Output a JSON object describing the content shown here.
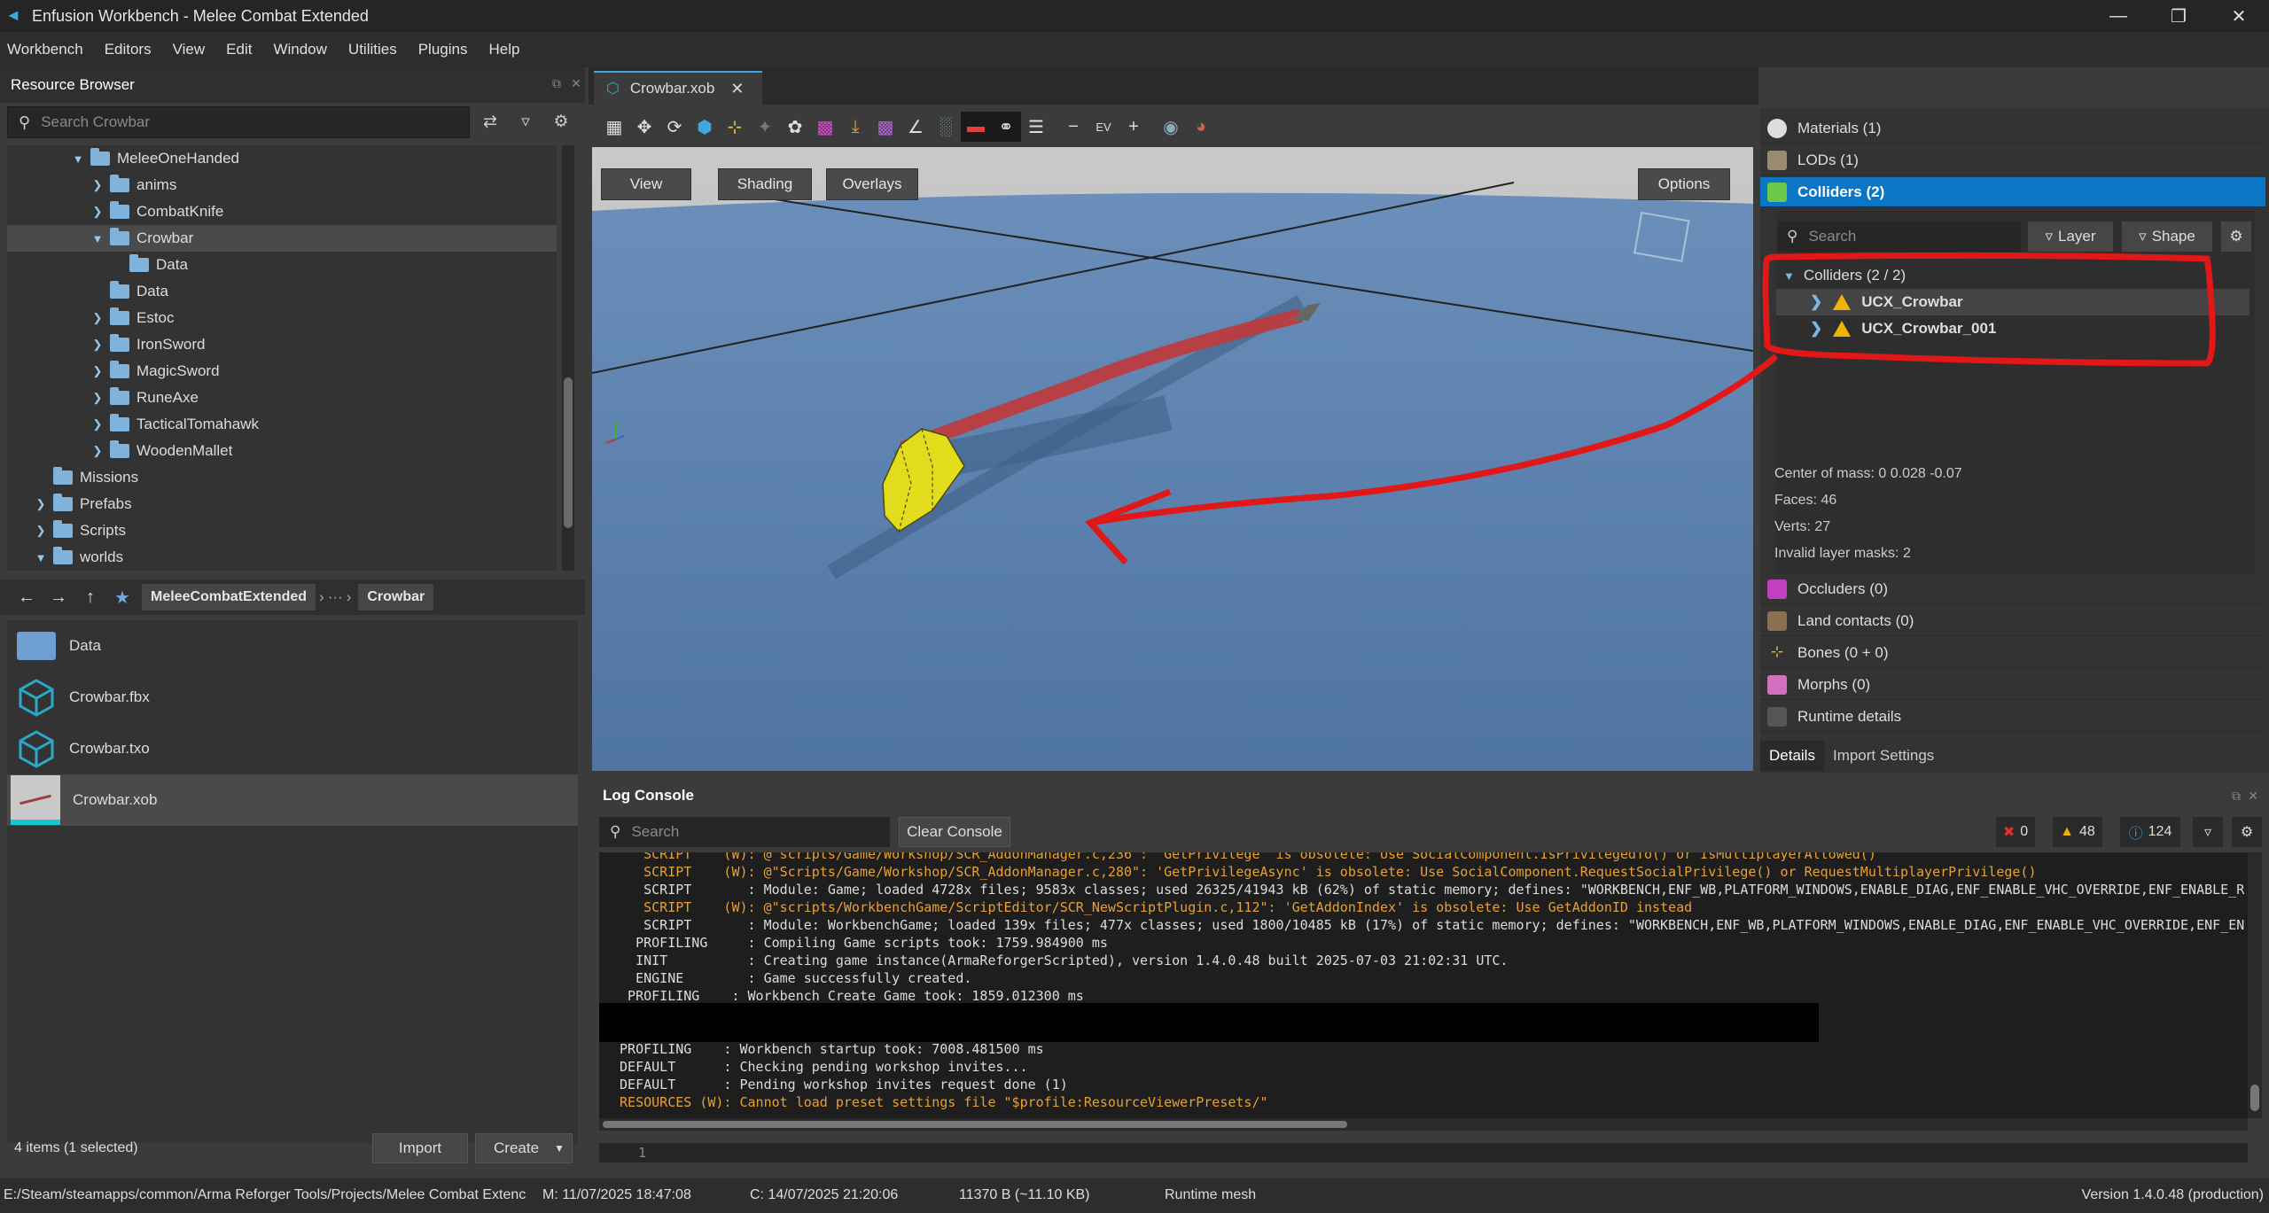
{
  "window": {
    "title": "Enfusion Workbench - Melee Combat Extended",
    "minimize": "—",
    "maximize": "❐",
    "close": "✕"
  },
  "menu": [
    "Workbench",
    "Editors",
    "View",
    "Edit",
    "Window",
    "Utilities",
    "Plugins",
    "Help"
  ],
  "resource_browser": {
    "title": "Resource Browser",
    "search_placeholder": "Search Crowbar",
    "tree": [
      {
        "label": "MeleeOneHanded",
        "expanded": true
      },
      {
        "label": "anims",
        "expanded": false
      },
      {
        "label": "CombatKnife",
        "expanded": false
      },
      {
        "label": "Crowbar",
        "expanded": true,
        "selected": true
      },
      {
        "label": "Data",
        "expanded": null
      },
      {
        "label": "Data",
        "expanded": null
      },
      {
        "label": "Estoc",
        "expanded": false
      },
      {
        "label": "IronSword",
        "expanded": false
      },
      {
        "label": "MagicSword",
        "expanded": false
      },
      {
        "label": "RuneAxe",
        "expanded": false
      },
      {
        "label": "TacticalTomahawk",
        "expanded": false
      },
      {
        "label": "WoodenMallet",
        "expanded": false
      },
      {
        "label": "Missions",
        "expanded": null
      },
      {
        "label": "Prefabs",
        "expanded": false
      },
      {
        "label": "Scripts",
        "expanded": false
      },
      {
        "label": "worlds",
        "expanded": true
      }
    ],
    "breadcrumb": [
      "MeleeCombatExtended",
      "···",
      "Crowbar"
    ],
    "files": [
      {
        "name": "Data",
        "icon": "folder-icon"
      },
      {
        "name": "Crowbar.fbx",
        "icon": "cube-icon"
      },
      {
        "name": "Crowbar.txo",
        "icon": "cube-icon"
      },
      {
        "name": "Crowbar.xob",
        "icon": "mesh-thumbnail",
        "selected": true
      }
    ],
    "footer_status": "4 items (1 selected)",
    "import_label": "Import",
    "create_label": "Create"
  },
  "editor": {
    "tab_label": "Crowbar.xob",
    "view_label": "View",
    "shading_label": "Shading",
    "overlays_label": "Overlays",
    "options_label": "Options"
  },
  "right_panel": {
    "sections_top": [
      {
        "label": "Materials (1)",
        "icon": "materials-icon"
      },
      {
        "label": "LODs (1)",
        "icon": "lods-icon"
      },
      {
        "label": "Colliders (2)",
        "icon": "colliders-icon",
        "active": true
      }
    ],
    "collider_search_placeholder": "Search",
    "layer_label": "Layer",
    "shape_label": "Shape",
    "colliders_group": "Colliders (2 / 2)",
    "colliders": [
      "UCX_Crowbar",
      "UCX_Crowbar_001"
    ],
    "stats": [
      "Center of mass: 0 0.028 -0.07",
      "Faces: 46",
      "Verts: 27",
      "Invalid layer masks: 2"
    ],
    "sections_bottom": [
      {
        "label": "Occluders (0)",
        "icon": "occluders-icon"
      },
      {
        "label": "Land contacts (0)",
        "icon": "land-contacts-icon"
      },
      {
        "label": "Bones (0 + 0)",
        "icon": "bones-icon"
      },
      {
        "label": "Morphs (0)",
        "icon": "morphs-icon"
      },
      {
        "label": "Runtime details",
        "icon": "runtime-icon"
      }
    ],
    "tabs": [
      "Details",
      "Import Settings"
    ]
  },
  "log_console": {
    "title": "Log Console",
    "search_placeholder": "Search",
    "clear_label": "Clear Console",
    "errors": "0",
    "warnings": "48",
    "infos": "124",
    "lines": [
      {
        "text": "    SCRIPT    (W): @\"scripts/Game/Workshop/SCR_AddonManager.c,236\": 'GetPrivilege' is obsolete: Use SocialComponent.IsPrivilegedTo() or IsMultiplayerAllowed()",
        "color": "#e8a030"
      },
      {
        "text": "    SCRIPT    (W): @\"Scripts/Game/Workshop/SCR_AddonManager.c,280\": 'GetPrivilegeAsync' is obsolete: Use SocialComponent.RequestSocialPrivilege() or RequestMultiplayerPrivilege()",
        "color": "#e8a030"
      },
      {
        "text": "    SCRIPT       : Module: Game; loaded 4728x files; 9583x classes; used 26325/41943 kB (62%) of static memory; defines: \"WORKBENCH,ENF_WB,PLATFORM_WINDOWS,ENABLE_DIAG,ENF_ENABLE_VHC_OVERRIDE,ENF_ENABLE_R",
        "color": "#dcdcdc"
      },
      {
        "text": "    SCRIPT    (W): @\"scripts/WorkbenchGame/ScriptEditor/SCR_NewScriptPlugin.c,112\": 'GetAddonIndex' is obsolete: Use GetAddonID instead",
        "color": "#e8a030"
      },
      {
        "text": "    SCRIPT       : Module: WorkbenchGame; loaded 139x files; 477x classes; used 1800/10485 kB (17%) of static memory; defines: \"WORKBENCH,ENF_WB,PLATFORM_WINDOWS,ENABLE_DIAG,ENF_ENABLE_VHC_OVERRIDE,ENF_EN",
        "color": "#dcdcdc"
      },
      {
        "text": "   PROFILING     : Compiling Game scripts took: 1759.984900 ms",
        "color": "#dcdcdc"
      },
      {
        "text": "   INIT          : Creating game instance(ArmaReforgerScripted), version 1.4.0.48 built 2025-07-03 21:02:31 UTC.",
        "color": "#dcdcdc"
      },
      {
        "text": "   ENGINE        : Game successfully created.",
        "color": "#dcdcdc"
      },
      {
        "text": "  PROFILING    : Workbench Create Game took: 1859.012300 ms",
        "color": "#dcdcdc"
      },
      {
        "text": "",
        "color": "#dcdcdc"
      },
      {
        "text": "",
        "color": "#dcdcdc"
      },
      {
        "text": " PROFILING    : Workbench startup took: 7008.481500 ms",
        "color": "#dcdcdc"
      },
      {
        "text": " DEFAULT      : Checking pending workshop invites...",
        "color": "#dcdcdc"
      },
      {
        "text": " DEFAULT      : Pending workshop invites request done (1)",
        "color": "#dcdcdc"
      },
      {
        "text": " RESOURCES (W): Cannot load preset settings file \"$profile:ResourceViewerPresets/\"",
        "color": "#e8a030"
      }
    ],
    "input_line_number": "1"
  },
  "status_bar": {
    "path": "E:/Steam/steamapps/common/Arma Reforger Tools/Projects/Melee Combat Extenc",
    "modified": "M: 11/07/2025 18:47:08",
    "created": "C: 14/07/2025 21:20:06",
    "size": "11370 B (~11.10 KB)",
    "type": "Runtime mesh",
    "version": "Version 1.4.0.48 (production)"
  },
  "colors": {
    "accent": "#0b76c5",
    "annotation": "#e01818",
    "collider": "#e0d81c",
    "warning": "#f0b400"
  }
}
